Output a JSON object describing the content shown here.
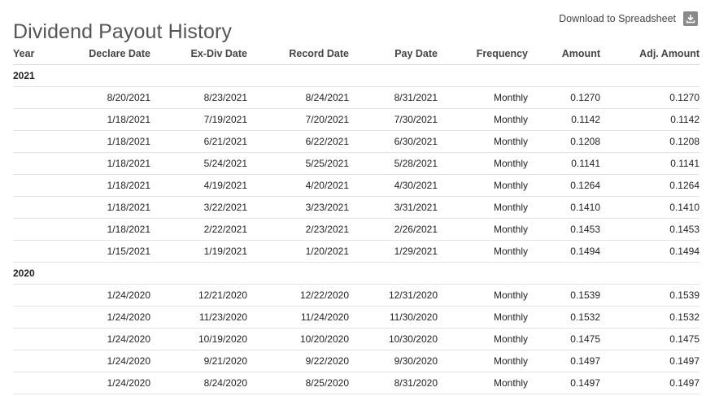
{
  "header": {
    "title": "Dividend Payout History",
    "download_label": "Download to Spreadsheet"
  },
  "table": {
    "columns": [
      "Year",
      "Declare Date",
      "Ex-Div Date",
      "Record Date",
      "Pay Date",
      "Frequency",
      "Amount",
      "Adj. Amount"
    ],
    "groups": [
      {
        "year": "2021",
        "rows": [
          [
            "8/20/2021",
            "8/23/2021",
            "8/24/2021",
            "8/31/2021",
            "Monthly",
            "0.1270",
            "0.1270"
          ],
          [
            "1/18/2021",
            "7/19/2021",
            "7/20/2021",
            "7/30/2021",
            "Monthly",
            "0.1142",
            "0.1142"
          ],
          [
            "1/18/2021",
            "6/21/2021",
            "6/22/2021",
            "6/30/2021",
            "Monthly",
            "0.1208",
            "0.1208"
          ],
          [
            "1/18/2021",
            "5/24/2021",
            "5/25/2021",
            "5/28/2021",
            "Monthly",
            "0.1141",
            "0.1141"
          ],
          [
            "1/18/2021",
            "4/19/2021",
            "4/20/2021",
            "4/30/2021",
            "Monthly",
            "0.1264",
            "0.1264"
          ],
          [
            "1/18/2021",
            "3/22/2021",
            "3/23/2021",
            "3/31/2021",
            "Monthly",
            "0.1410",
            "0.1410"
          ],
          [
            "1/18/2021",
            "2/22/2021",
            "2/23/2021",
            "2/26/2021",
            "Monthly",
            "0.1453",
            "0.1453"
          ],
          [
            "1/15/2021",
            "1/19/2021",
            "1/20/2021",
            "1/29/2021",
            "Monthly",
            "0.1494",
            "0.1494"
          ]
        ]
      },
      {
        "year": "2020",
        "rows": [
          [
            "1/24/2020",
            "12/21/2020",
            "12/22/2020",
            "12/31/2020",
            "Monthly",
            "0.1539",
            "0.1539"
          ],
          [
            "1/24/2020",
            "11/23/2020",
            "11/24/2020",
            "11/30/2020",
            "Monthly",
            "0.1532",
            "0.1532"
          ],
          [
            "1/24/2020",
            "10/19/2020",
            "10/20/2020",
            "10/30/2020",
            "Monthly",
            "0.1475",
            "0.1475"
          ],
          [
            "1/24/2020",
            "9/21/2020",
            "9/22/2020",
            "9/30/2020",
            "Monthly",
            "0.1497",
            "0.1497"
          ],
          [
            "1/24/2020",
            "8/24/2020",
            "8/25/2020",
            "8/31/2020",
            "Monthly",
            "0.1497",
            "0.1497"
          ]
        ]
      }
    ]
  },
  "icons": {
    "download": "download-icon"
  },
  "colors": {
    "title": "#555555",
    "icon_bg": "#8a8a8a",
    "row_border": "#e3e3e3"
  }
}
